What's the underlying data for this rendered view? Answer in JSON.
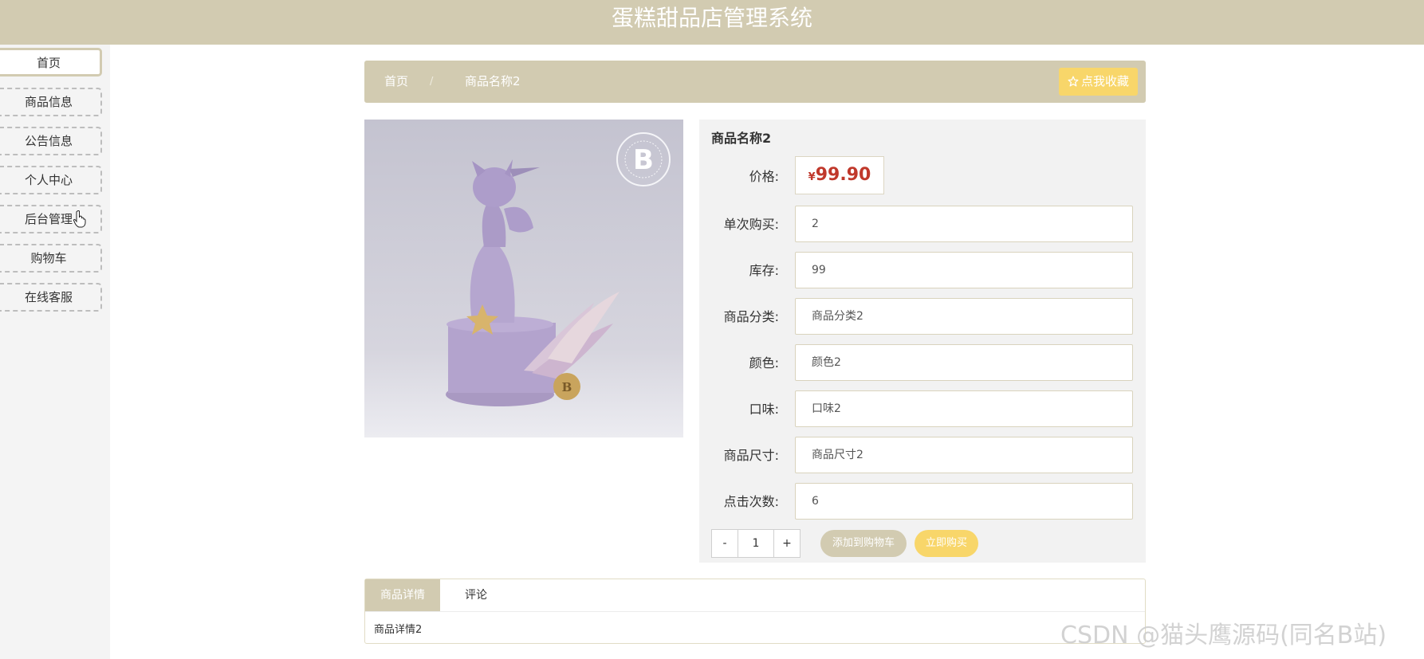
{
  "header": {
    "title": "蛋糕甜品店管理系统"
  },
  "sidebar": {
    "items": [
      {
        "label": "首页"
      },
      {
        "label": "商品信息"
      },
      {
        "label": "公告信息"
      },
      {
        "label": "个人中心"
      },
      {
        "label": "后台管理"
      },
      {
        "label": "购物车"
      },
      {
        "label": "在线客服"
      }
    ]
  },
  "breadcrumb": {
    "home": "首页",
    "separator": "/",
    "current": "商品名称2"
  },
  "favorite_button": {
    "label": "点我收藏",
    "icon": "star-outline-icon"
  },
  "product": {
    "name": "商品名称2",
    "image_badge": "B",
    "price_label": "价格:",
    "currency": "¥",
    "price": "99.90",
    "fields": [
      {
        "label": "单次购买:",
        "value": "2"
      },
      {
        "label": "库存:",
        "value": "99"
      },
      {
        "label": "商品分类:",
        "value": "商品分类2"
      },
      {
        "label": "颜色:",
        "value": "颜色2"
      },
      {
        "label": "口味:",
        "value": "口味2"
      },
      {
        "label": "商品尺寸:",
        "value": "商品尺寸2"
      },
      {
        "label": "点击次数:",
        "value": "6"
      }
    ],
    "quantity": {
      "minus": "-",
      "value": "1",
      "plus": "+"
    },
    "add_to_cart": "添加到购物车",
    "buy_now": "立即购买"
  },
  "tabs": {
    "items": [
      {
        "label": "商品详情"
      },
      {
        "label": "评论"
      }
    ],
    "content": "商品详情2"
  },
  "watermark": "CSDN @猫头鹰源码(同名B站)",
  "colors": {
    "accent": "#d2cbb1",
    "yellow": "#f8d66a",
    "price": "#c0382b"
  }
}
